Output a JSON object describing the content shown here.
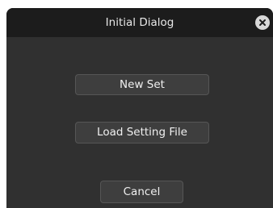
{
  "dialog": {
    "title": "Initial Dialog",
    "close_icon": "close-icon",
    "buttons": {
      "new_set": "New Set",
      "load_setting_file": "Load Setting File",
      "cancel": "Cancel"
    }
  },
  "colors": {
    "titlebar": "#1c1c1c",
    "body": "#303030",
    "button": "#3e3e3e",
    "button_border": "#565656",
    "text": "#f0f0f0",
    "close_circle": "#d8d8d8"
  }
}
